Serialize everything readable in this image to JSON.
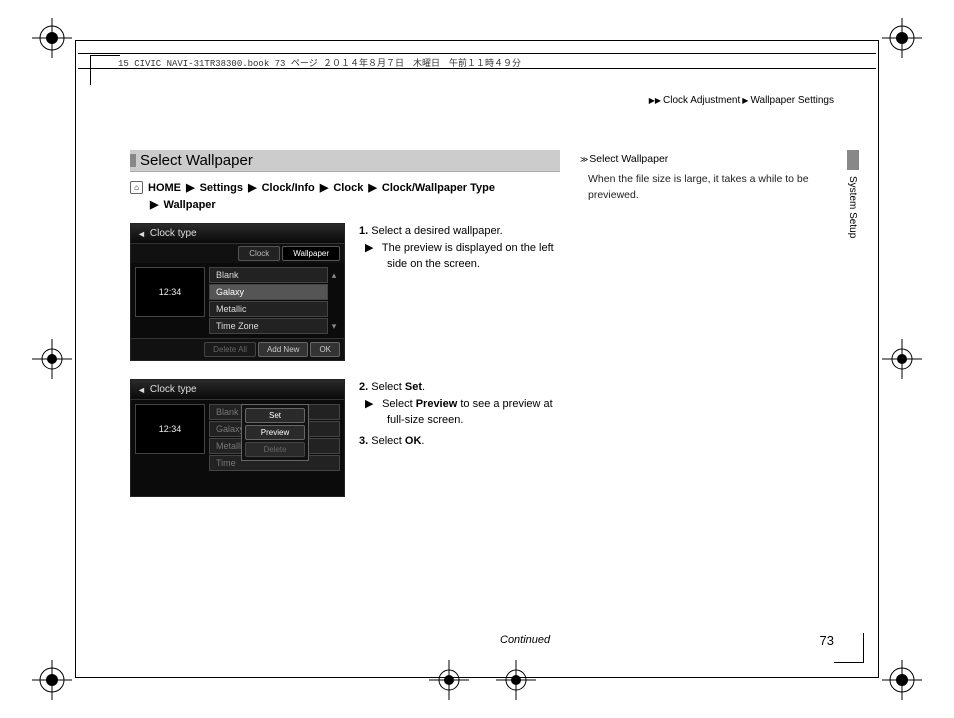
{
  "book_header": "15 CIVIC NAVI-31TR38300.book  73 ページ  ２０１４年８月７日　木曜日　午前１１時４９分",
  "breadcrumb_top": {
    "a": "Clock Adjustment",
    "b": "Wallpaper Settings"
  },
  "section_title": "Select Wallpaper",
  "nav_path": {
    "home": "HOME",
    "p1": "Settings",
    "p2": "Clock/Info",
    "p3": "Clock",
    "p4": "Clock/Wallpaper Type",
    "p5": "Wallpaper"
  },
  "ui1": {
    "title": "Clock type",
    "tab_clock": "Clock",
    "tab_wallpaper": "Wallpaper",
    "preview_time": "12:34",
    "items": [
      "Blank",
      "Galaxy",
      "Metallic",
      "Time Zone"
    ],
    "btn_delete_all": "Delete All",
    "btn_add_new": "Add New",
    "btn_ok": "OK",
    "selected_index": 1
  },
  "ui2": {
    "title": "Clock type",
    "preview_time": "12:34",
    "items_dim": [
      "Blank",
      "Galaxy",
      "Metallic",
      "Time"
    ],
    "popup_set": "Set",
    "popup_preview": "Preview",
    "popup_delete": "Delete"
  },
  "steps": {
    "s1_num": "1.",
    "s1": "Select a desired wallpaper.",
    "s1_sub": "The preview is displayed on the left side on the screen.",
    "s2_num": "2.",
    "s2_a": "Select ",
    "s2_b": "Set",
    "s2_c": ".",
    "s2_sub_a": "Select ",
    "s2_sub_b": "Preview",
    "s2_sub_c": " to see a preview at full-size screen.",
    "s3_num": "3.",
    "s3_a": "Select ",
    "s3_b": "OK",
    "s3_c": "."
  },
  "sidebar": {
    "title": "Select Wallpaper",
    "body": "When the file size is large, it takes a while to be previewed."
  },
  "side_tab": "System Setup",
  "continued": "Continued",
  "page_number": "73"
}
